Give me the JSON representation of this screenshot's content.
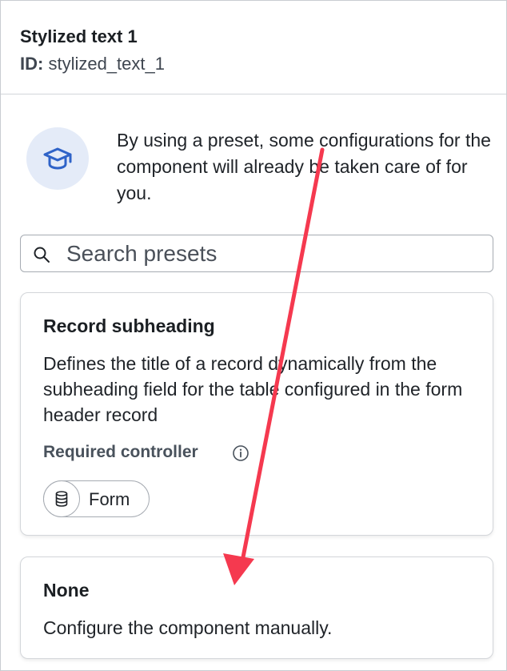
{
  "header": {
    "title": "Stylized text 1",
    "id_label": "ID:",
    "id_value": "stylized_text_1"
  },
  "info": {
    "icon": "graduation-cap-icon",
    "text": "By using a preset, some configurations for the component will already be taken care of for you."
  },
  "search": {
    "placeholder": "Search presets",
    "value": ""
  },
  "presets": [
    {
      "title": "Record subheading",
      "description": "Defines the title of a record dynamically from the subheading field for the table configured in the form header record",
      "required_label": "Required controller",
      "controller": "Form"
    },
    {
      "title": "None",
      "description": "Configure the component manually."
    }
  ],
  "colors": {
    "accent": "#2f63c8",
    "icon_bg": "#e4ebf8",
    "annotation_arrow": "#f5394f",
    "border": "#d3d6da"
  }
}
